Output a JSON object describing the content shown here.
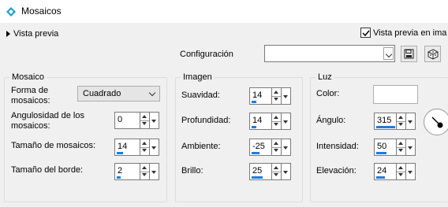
{
  "window": {
    "title": "Mosaicos",
    "icon": "app-icon"
  },
  "toolbar": {
    "preview_toggle_label": "Vista previa",
    "preview_check_label": "Vista previa en ima",
    "preview_checked": true,
    "config_label": "Configuración",
    "config_value": "",
    "save_icon": "save-icon",
    "dice_icon": "dice-icon"
  },
  "groups": {
    "mosaico": {
      "title": "Mosaico",
      "shape_label_1": "Forma de",
      "shape_label_2": "mosaicos:",
      "shape_value": "Cuadrado",
      "angularity_label_1": "Angulosidad de los",
      "angularity_label_2": "mosaicos:",
      "angularity_value": "0",
      "tile_size_label": "Tamaño de mosaicos:",
      "tile_size_value": "14",
      "border_size_label": "Tamaño del borde:",
      "border_size_value": "2"
    },
    "imagen": {
      "title": "Imagen",
      "smoothness_label": "Suavidad:",
      "smoothness_value": "14",
      "depth_label": "Profundidad:",
      "depth_value": "14",
      "ambient_label": "Ambiente:",
      "ambient_value": "-25",
      "brightness_label": "Brillo:",
      "brightness_value": "25"
    },
    "luz": {
      "title": "Luz",
      "color_label": "Color:",
      "color_value": "#ffffff",
      "angle_label": "Ángulo:",
      "angle_value": "315",
      "intensity_label": "Intensidad:",
      "intensity_value": "50",
      "elevation_label": "Elevación:",
      "elevation_value": "24"
    }
  },
  "colors": {
    "accent": "#1e7be0",
    "panel": "#f0f0f0"
  }
}
